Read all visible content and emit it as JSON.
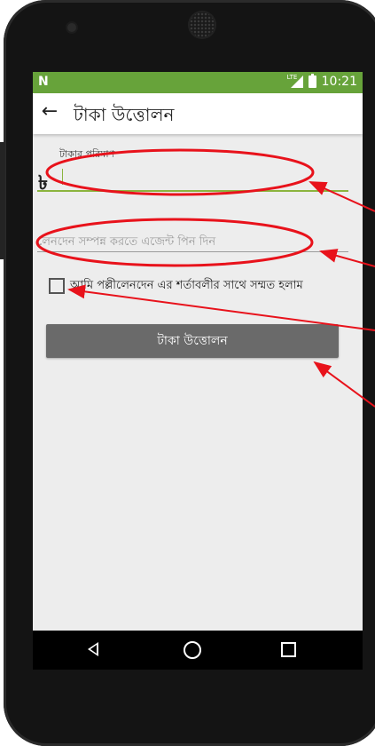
{
  "status_bar": {
    "notification_icon": "N",
    "network_label": "LTE",
    "time": "10:21"
  },
  "app_bar": {
    "back_icon": "←",
    "title": "টাকা উত্তোলন"
  },
  "form": {
    "amount_label": "টাকার পরিমাণ",
    "currency_symbol": "৳",
    "amount_value": "",
    "pin_placeholder": "লেনদেন সম্পন্ন করতে এজেন্ট পিন দিন",
    "agree_text": "আমি পল্লীলেনদেন এর শর্তাবলীর সাথে সম্মত হলাম",
    "agree_checked": false,
    "submit_label": "টাকা উত্তোলন"
  },
  "colors": {
    "status_bar": "#67a33a",
    "accent_line": "#8bb43e",
    "button": "#6a6a6a",
    "annotation": "#e8121b"
  }
}
